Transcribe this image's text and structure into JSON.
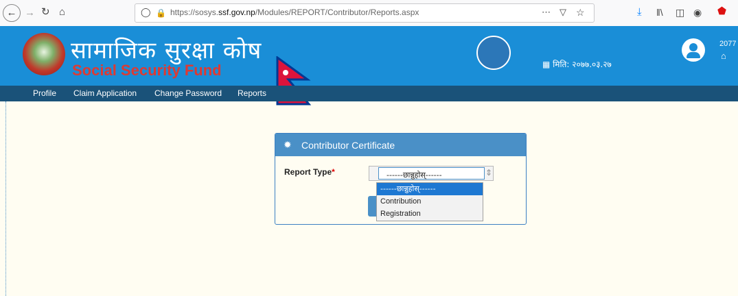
{
  "browser": {
    "url_prefix": "https://sosys.",
    "url_domain": "ssf.gov.np",
    "url_path": "/Modules/REPORT/Contributor/Reports.aspx",
    "icons": [
      "back-icon",
      "forward-icon",
      "reload-icon",
      "home-icon",
      "shield-icon",
      "lock-icon",
      "more-icon",
      "pocket-icon",
      "bookmark-star-icon",
      "download-icon",
      "library-icon",
      "sidebar-icon",
      "account-icon",
      "ublock-icon"
    ]
  },
  "header": {
    "title_np": "सामाजिक सुरक्षा कोष",
    "title_en": "Social Security Fund",
    "date_label": "मिति: २०७७.०३.२७",
    "year_partial": "2077",
    "colors": {
      "header_bg": "#1a8ed7",
      "nav_bg": "#1a5279",
      "title_en": "#e8362b"
    }
  },
  "nav": {
    "items": [
      "Profile",
      "Claim Application",
      "Change Password",
      "Reports"
    ]
  },
  "panel": {
    "title": "Contributor Certificate",
    "field_label": "Report Type",
    "required_mark": "*",
    "selected_value": "------छान्नुहोस्------"
  },
  "dropdown": {
    "options": [
      "------छान्नुहोस्------",
      "Contribution",
      "Registration"
    ],
    "highlighted_index": 0
  }
}
